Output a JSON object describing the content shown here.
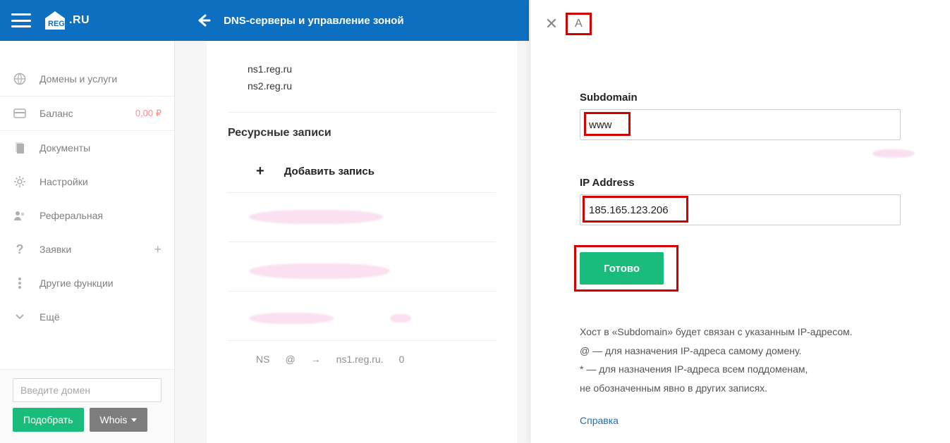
{
  "header": {
    "logo_text": "REG",
    "logo_suffix": ".RU",
    "page_title": "DNS-серверы и управление зоной"
  },
  "sidebar": {
    "items": [
      {
        "icon": "globe-icon",
        "label": "Домены и услуги"
      },
      {
        "icon": "wallet-icon",
        "label": "Баланс",
        "extra": "0,00 ₽"
      },
      {
        "icon": "docs-icon",
        "label": "Документы"
      },
      {
        "icon": "gear-icon",
        "label": "Настройки"
      },
      {
        "icon": "people-icon",
        "label": "Реферальная"
      },
      {
        "icon": "question-icon",
        "label": "Заявки",
        "plus": true
      },
      {
        "icon": "dots-icon",
        "label": "Другие функции"
      },
      {
        "icon": "chevron-down-icon",
        "label": "Ещё"
      }
    ],
    "domain_placeholder": "Введите домен",
    "search_btn": "Подобрать",
    "whois_btn": "Whois"
  },
  "main": {
    "ns": [
      "ns1.reg.ru",
      "ns2.reg.ru"
    ],
    "section_title": "Ресурсные записи",
    "add_label": "Добавить запись",
    "ns_row": {
      "type": "NS",
      "host": "@",
      "arrow": "→",
      "value": "ns1.reg.ru.",
      "ttl": "0"
    }
  },
  "drawer": {
    "record_type": "A",
    "subdomain_label": "Subdomain",
    "subdomain_value": "www",
    "ip_label": "IP Address",
    "ip_value": "185.165.123.206",
    "submit_label": "Готово",
    "help_lines": [
      "Хост в «Subdomain» будет связан с указанным IP-адресом.",
      "@ — для назначения IP-адреса самому домену.",
      "* — для назначения IP-адреса всем поддоменам,",
      "не обозначенным явно в других записях."
    ],
    "help_link": "Справка"
  }
}
